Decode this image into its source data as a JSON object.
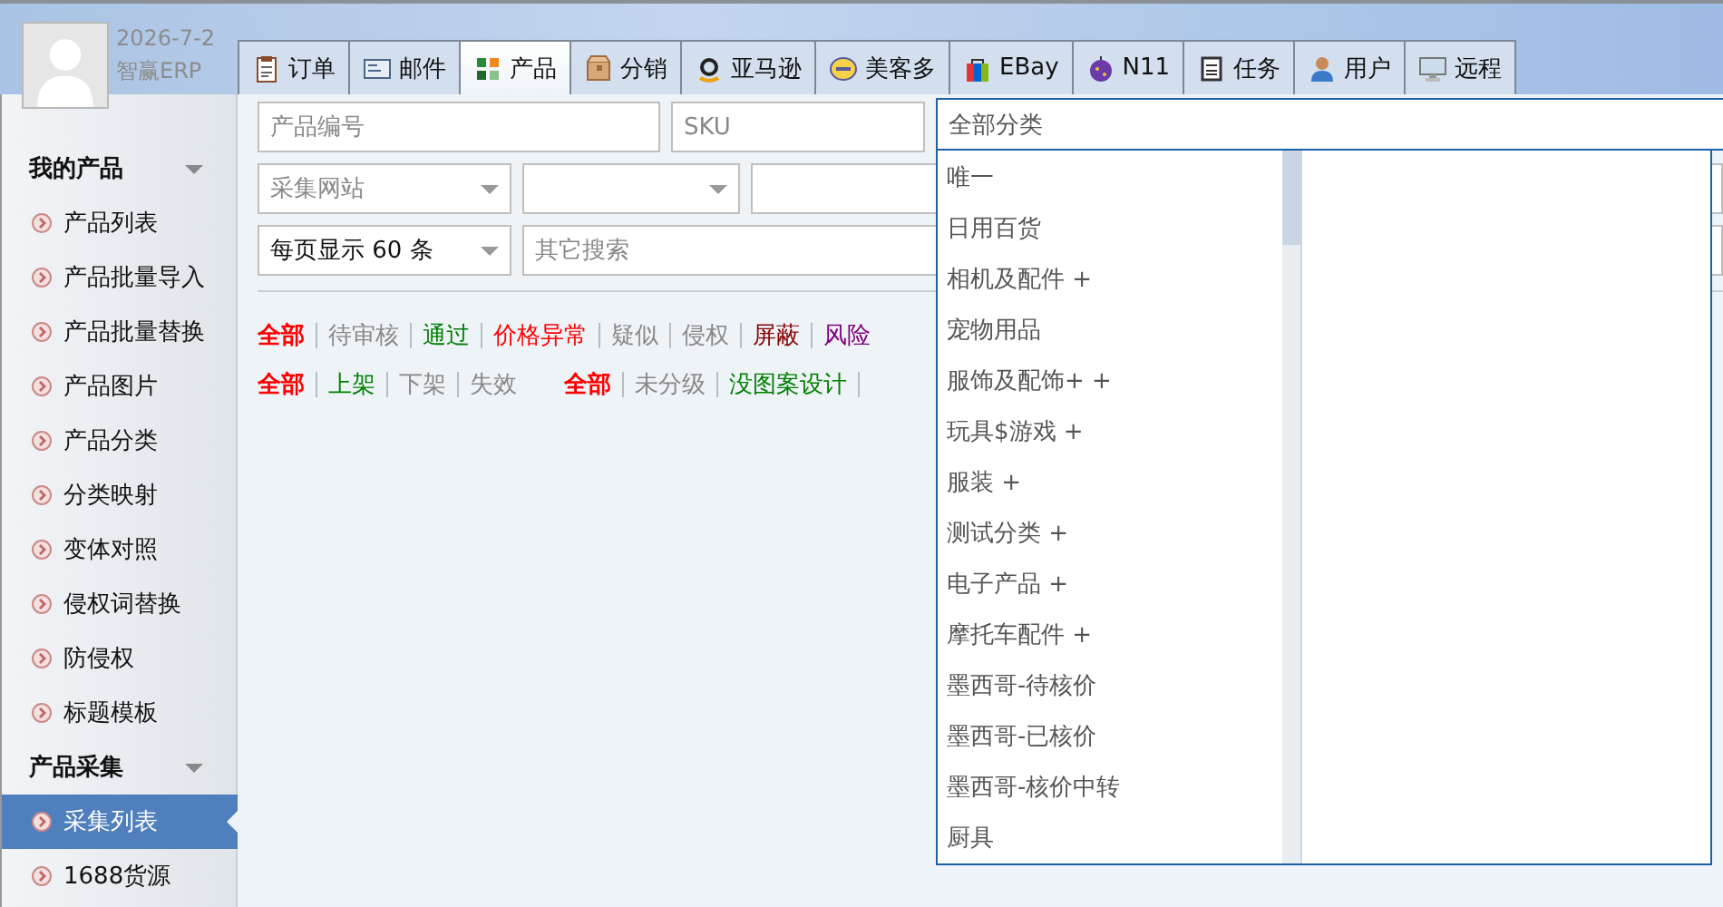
{
  "header": {
    "date": "2026-7-2",
    "brand": "智赢ERP"
  },
  "tabs": [
    {
      "label": "订单",
      "selected": false
    },
    {
      "label": "邮件",
      "selected": false
    },
    {
      "label": "产品",
      "selected": true
    },
    {
      "label": "分销",
      "selected": false
    },
    {
      "label": "亚马逊",
      "selected": false
    },
    {
      "label": "美客多",
      "selected": false
    },
    {
      "label": "EBay",
      "selected": false
    },
    {
      "label": "N11",
      "selected": false
    },
    {
      "label": "任务",
      "selected": false
    },
    {
      "label": "用户",
      "selected": false
    },
    {
      "label": "远程",
      "selected": false
    }
  ],
  "sidebar": {
    "groups": [
      {
        "title": "我的产品",
        "expanded": true,
        "items": [
          {
            "label": "产品列表",
            "selected": false
          },
          {
            "label": "产品批量导入",
            "selected": false
          },
          {
            "label": "产品批量替换",
            "selected": false
          },
          {
            "label": "产品图片",
            "selected": false
          },
          {
            "label": "产品分类",
            "selected": false
          },
          {
            "label": "分类映射",
            "selected": false
          },
          {
            "label": "变体对照",
            "selected": false
          },
          {
            "label": "侵权词替换",
            "selected": false
          },
          {
            "label": "防侵权",
            "selected": false
          },
          {
            "label": "标题模板",
            "selected": false
          }
        ]
      },
      {
        "title": "产品采集",
        "expanded": true,
        "items": [
          {
            "label": "采集列表",
            "selected": true
          },
          {
            "label": "1688货源",
            "selected": false
          }
        ]
      }
    ]
  },
  "search": {
    "product_no": {
      "placeholder": "产品编号"
    },
    "sku": {
      "placeholder": "SKU"
    },
    "site": {
      "placeholder": "采集网站"
    },
    "per_page": {
      "value": "每页显示 60 条"
    },
    "other": {
      "placeholder": "其它搜索"
    }
  },
  "filters": [
    [
      {
        "label": "全部",
        "selected": true,
        "color": "#ff0000"
      },
      {
        "label": "待审核",
        "selected": false,
        "color": "#888888"
      },
      {
        "label": "通过",
        "selected": false,
        "color": "#008000"
      },
      {
        "label": "价格异常",
        "selected": false,
        "color": "#ff0000"
      },
      {
        "label": "疑似",
        "selected": false,
        "color": "#888888"
      },
      {
        "label": "侵权",
        "selected": false,
        "color": "#888888"
      },
      {
        "label": "屏蔽",
        "selected": false,
        "color": "#8b0000"
      },
      {
        "label": "风险",
        "selected": false,
        "color": "#800080"
      }
    ],
    [
      {
        "label": "全部",
        "selected": true,
        "color": "#ff0000"
      },
      {
        "label": "上架",
        "selected": false,
        "color": "#008000"
      },
      {
        "label": "下架",
        "selected": false,
        "color": "#888888"
      },
      {
        "label": "失效",
        "selected": false,
        "color": "#888888"
      }
    ],
    [
      {
        "label": "全部",
        "selected": true,
        "color": "#ff0000"
      },
      {
        "label": "未分级",
        "selected": false,
        "color": "#888888"
      },
      {
        "label": "没图案设计",
        "selected": false,
        "color": "#008000"
      }
    ]
  ],
  "category_dropdown": {
    "value": "全部分类",
    "options": [
      "唯一",
      "日用百货",
      "相机及配件 +",
      "宠物用品",
      "服饰及配饰+ +",
      "玩具$游戏 +",
      "服装 +",
      "测试分类 +",
      "电子产品 +",
      "摩托车配件 +",
      "墨西哥-待核价",
      "墨西哥-已核价",
      "墨西哥-核价中转",
      "厨具"
    ]
  }
}
